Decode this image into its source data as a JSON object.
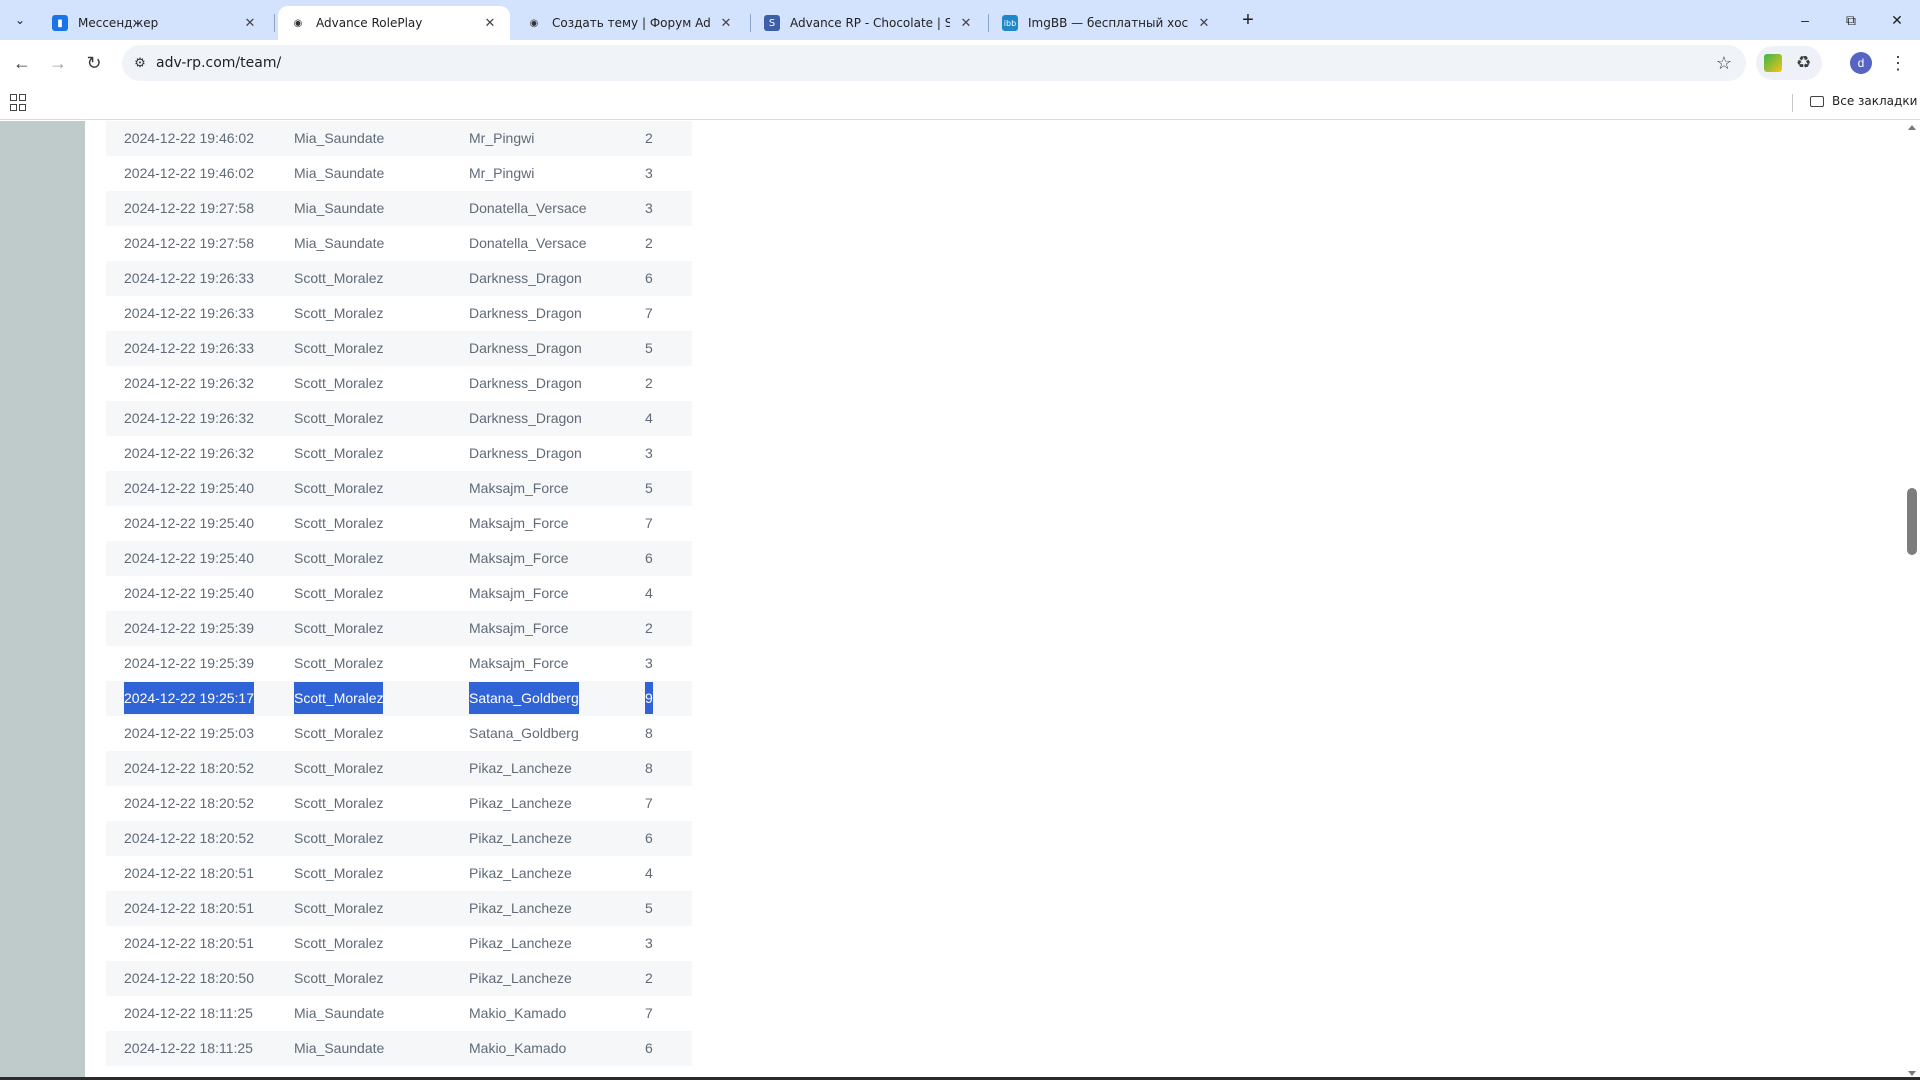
{
  "browser": {
    "tabs": [
      {
        "title": "Мессенджер",
        "favicon": "messenger-icon",
        "active": false
      },
      {
        "title": "Advance RolePlay",
        "favicon": "eye-icon",
        "active": true
      },
      {
        "title": "Создать тему | Форум Advance",
        "favicon": "eye-icon",
        "active": false
      },
      {
        "title": "Advance RP - Chocolate | SAMP",
        "favicon": "s-icon",
        "active": false
      },
      {
        "title": "ImgBB — бесплатный хостинг",
        "favicon": "ibb-icon",
        "active": false
      }
    ],
    "url": "adv-rp.com/team/",
    "avatar_letter": "d",
    "bookmarks_label": "Все закладки",
    "accent_color": "#d3e3fd",
    "selection_color": "#2f63d6"
  },
  "table": {
    "rows": [
      {
        "date": "2024-12-22 19:46:02",
        "admin": "Mia_Saundate",
        "player": "Mr_Pingwi",
        "num": "2"
      },
      {
        "date": "2024-12-22 19:46:02",
        "admin": "Mia_Saundate",
        "player": "Mr_Pingwi",
        "num": "3"
      },
      {
        "date": "2024-12-22 19:27:58",
        "admin": "Mia_Saundate",
        "player": "Donatella_Versace",
        "num": "3"
      },
      {
        "date": "2024-12-22 19:27:58",
        "admin": "Mia_Saundate",
        "player": "Donatella_Versace",
        "num": "2"
      },
      {
        "date": "2024-12-22 19:26:33",
        "admin": "Scott_Moralez",
        "player": "Darkness_Dragon",
        "num": "6"
      },
      {
        "date": "2024-12-22 19:26:33",
        "admin": "Scott_Moralez",
        "player": "Darkness_Dragon",
        "num": "7"
      },
      {
        "date": "2024-12-22 19:26:33",
        "admin": "Scott_Moralez",
        "player": "Darkness_Dragon",
        "num": "5"
      },
      {
        "date": "2024-12-22 19:26:32",
        "admin": "Scott_Moralez",
        "player": "Darkness_Dragon",
        "num": "2"
      },
      {
        "date": "2024-12-22 19:26:32",
        "admin": "Scott_Moralez",
        "player": "Darkness_Dragon",
        "num": "4"
      },
      {
        "date": "2024-12-22 19:26:32",
        "admin": "Scott_Moralez",
        "player": "Darkness_Dragon",
        "num": "3"
      },
      {
        "date": "2024-12-22 19:25:40",
        "admin": "Scott_Moralez",
        "player": "Maksajm_Force",
        "num": "5"
      },
      {
        "date": "2024-12-22 19:25:40",
        "admin": "Scott_Moralez",
        "player": "Maksajm_Force",
        "num": "7"
      },
      {
        "date": "2024-12-22 19:25:40",
        "admin": "Scott_Moralez",
        "player": "Maksajm_Force",
        "num": "6"
      },
      {
        "date": "2024-12-22 19:25:40",
        "admin": "Scott_Moralez",
        "player": "Maksajm_Force",
        "num": "4"
      },
      {
        "date": "2024-12-22 19:25:39",
        "admin": "Scott_Moralez",
        "player": "Maksajm_Force",
        "num": "2"
      },
      {
        "date": "2024-12-22 19:25:39",
        "admin": "Scott_Moralez",
        "player": "Maksajm_Force",
        "num": "3"
      },
      {
        "date": "2024-12-22 19:25:17",
        "admin": "Scott_Moralez",
        "player": "Satana_Goldberg",
        "num": "9",
        "selected": true
      },
      {
        "date": "2024-12-22 19:25:03",
        "admin": "Scott_Moralez",
        "player": "Satana_Goldberg",
        "num": "8"
      },
      {
        "date": "2024-12-22 18:20:52",
        "admin": "Scott_Moralez",
        "player": "Pikaz_Lancheze",
        "num": "8"
      },
      {
        "date": "2024-12-22 18:20:52",
        "admin": "Scott_Moralez",
        "player": "Pikaz_Lancheze",
        "num": "7"
      },
      {
        "date": "2024-12-22 18:20:52",
        "admin": "Scott_Moralez",
        "player": "Pikaz_Lancheze",
        "num": "6"
      },
      {
        "date": "2024-12-22 18:20:51",
        "admin": "Scott_Moralez",
        "player": "Pikaz_Lancheze",
        "num": "4"
      },
      {
        "date": "2024-12-22 18:20:51",
        "admin": "Scott_Moralez",
        "player": "Pikaz_Lancheze",
        "num": "5"
      },
      {
        "date": "2024-12-22 18:20:51",
        "admin": "Scott_Moralez",
        "player": "Pikaz_Lancheze",
        "num": "3"
      },
      {
        "date": "2024-12-22 18:20:50",
        "admin": "Scott_Moralez",
        "player": "Pikaz_Lancheze",
        "num": "2"
      },
      {
        "date": "2024-12-22 18:11:25",
        "admin": "Mia_Saundate",
        "player": "Makio_Kamado",
        "num": "7"
      },
      {
        "date": "2024-12-22 18:11:25",
        "admin": "Mia_Saundate",
        "player": "Makio_Kamado",
        "num": "6"
      }
    ]
  }
}
